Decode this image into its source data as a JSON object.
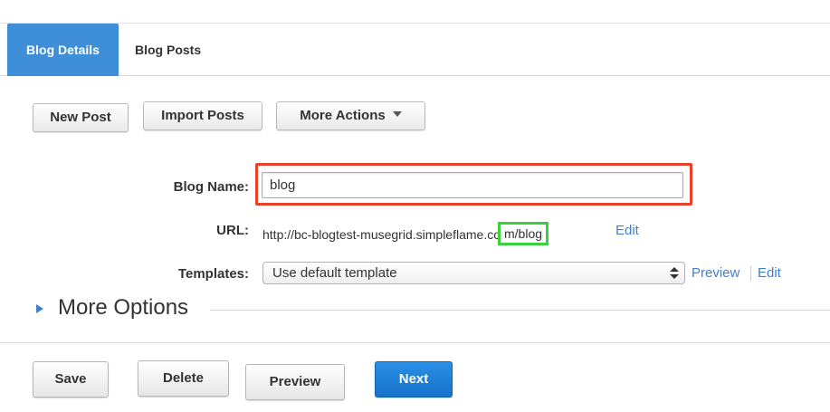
{
  "tabs": [
    {
      "label": "Blog Details",
      "active": true
    },
    {
      "label": "Blog Posts",
      "active": false
    }
  ],
  "toolbar": {
    "new_post": "New Post",
    "import_posts": "Import Posts",
    "more_actions": "More Actions"
  },
  "form": {
    "blog_name_label": "Blog Name:",
    "blog_name_value": "blog",
    "url_label": "URL:",
    "url_base": "http://bc-blogtest-musegrid.simpleflame.co",
    "url_slug": "m/blog",
    "url_edit": "Edit",
    "templates_label": "Templates:",
    "templates_selected": "Use default template",
    "templates_preview": "Preview",
    "templates_edit": "Edit"
  },
  "more_options": "More Options",
  "footer": {
    "save": "Save",
    "delete": "Delete",
    "preview": "Preview",
    "next": "Next"
  },
  "colors": {
    "active_tab": "#3f8fd8",
    "name_highlight": "#e8402a",
    "url_highlight": "#39d23a",
    "link": "#3f7fd0",
    "primary_button": "#1c7ad6"
  }
}
